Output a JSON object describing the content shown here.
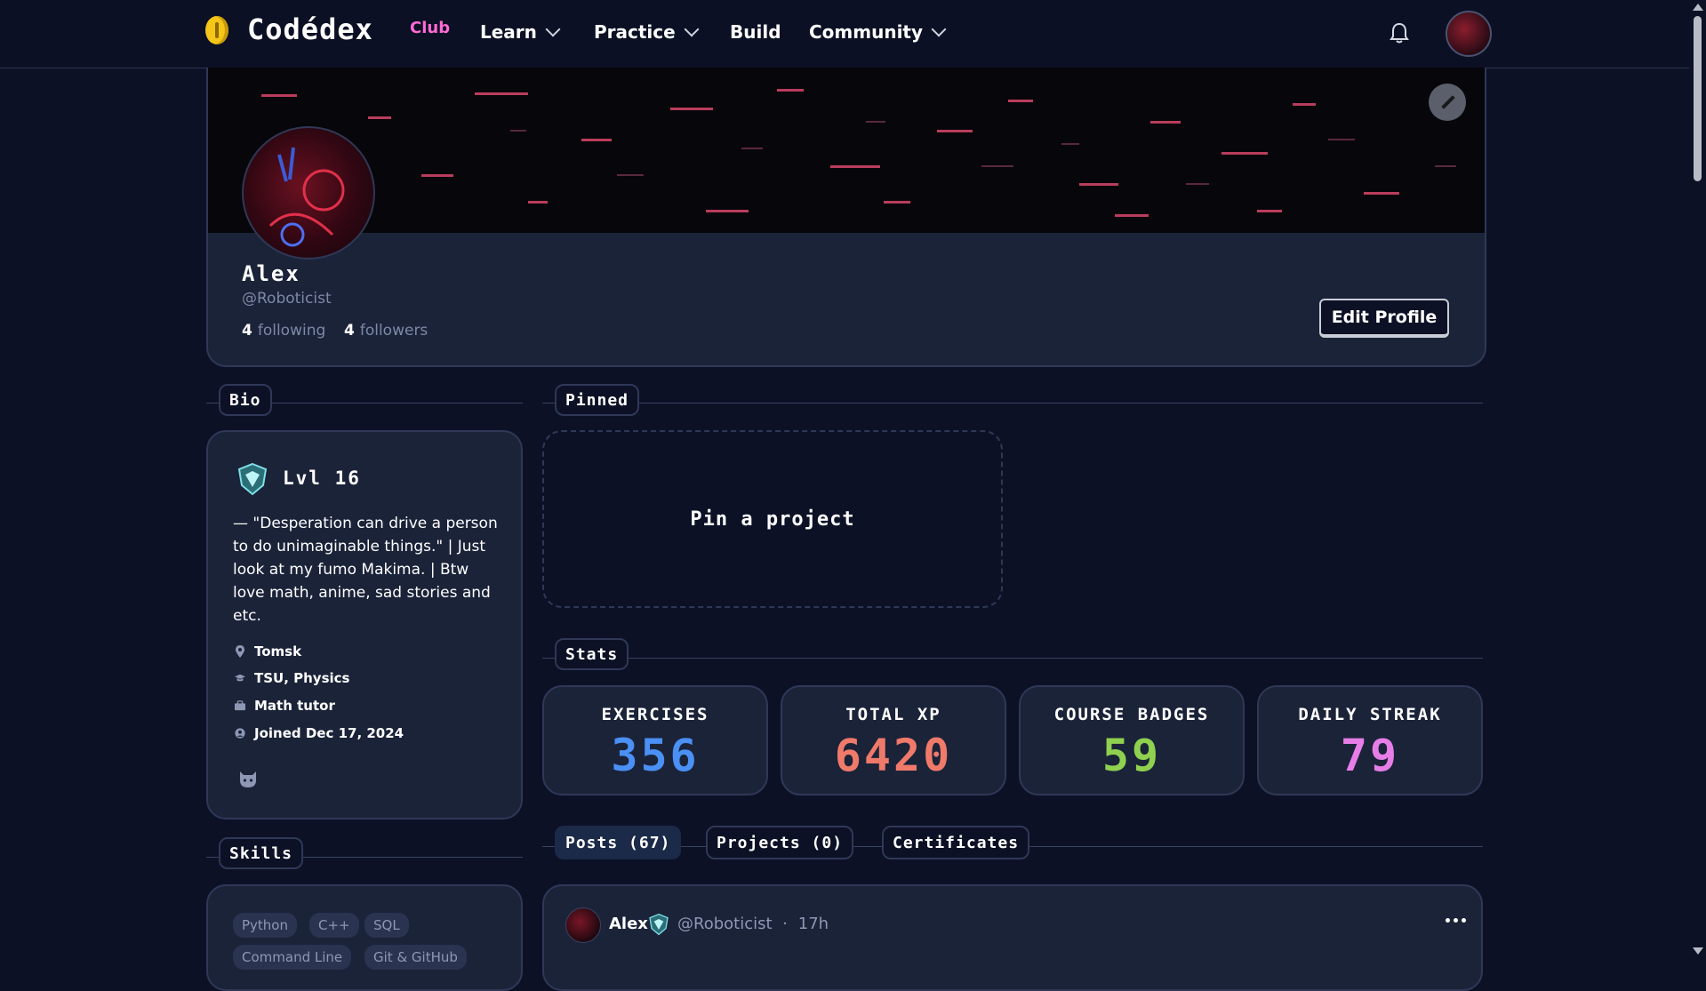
{
  "nav": {
    "brand": "Codédex",
    "brand_suffix": "Club",
    "items": [
      {
        "label": "Learn",
        "has_dropdown": true
      },
      {
        "label": "Practice",
        "has_dropdown": true
      },
      {
        "label": "Build",
        "has_dropdown": false
      },
      {
        "label": "Community",
        "has_dropdown": true
      }
    ],
    "icons": {
      "notifications": "bell-icon",
      "account": "avatar"
    }
  },
  "profile": {
    "name": "Alex",
    "handle": "@Roboticist",
    "following_count": "4",
    "following_label": "following",
    "followers_count": "4",
    "followers_label": "followers",
    "edit_profile_label": "Edit Profile"
  },
  "sections": {
    "bio": "Bio",
    "pinned": "Pinned",
    "stats": "Stats",
    "skills": "Skills"
  },
  "bio": {
    "level": "Lvl 16",
    "text": "— \"Desperation can drive a person to do unimaginable things.\" | Just look at my fumo Makima. | Btw love math, anime, sad stories and etc.",
    "location": "Tomsk",
    "education": "TSU, Physics",
    "work": "Math tutor",
    "joined": "Joined Dec 17, 2024"
  },
  "pinned": {
    "placeholder": "Pin a project"
  },
  "stats": [
    {
      "label": "EXERCISES",
      "value": "356",
      "color": "#4a90f5"
    },
    {
      "label": "TOTAL XP",
      "value": "6420",
      "color": "#f07a6a"
    },
    {
      "label": "COURSE BADGES",
      "value": "59",
      "color": "#8fd14f"
    },
    {
      "label": "DAILY STREAK",
      "value": "79",
      "color": "#e77ee8"
    }
  ],
  "tabs": [
    {
      "label": "Posts (67)",
      "active": true
    },
    {
      "label": "Projects (0)",
      "active": false
    },
    {
      "label": "Certificates",
      "active": false
    }
  ],
  "skills": [
    "Python",
    "C++",
    "SQL",
    "Command Line",
    "Git & GitHub"
  ],
  "post": {
    "author": "Alex",
    "handle": "@Roboticist",
    "separator": "·",
    "time": "17h"
  },
  "colors": {
    "background": "#0c1126",
    "card": "#1b2339",
    "border": "#2f3856",
    "brand_accent": "#ff6ad5",
    "coin": "#f5c518"
  }
}
